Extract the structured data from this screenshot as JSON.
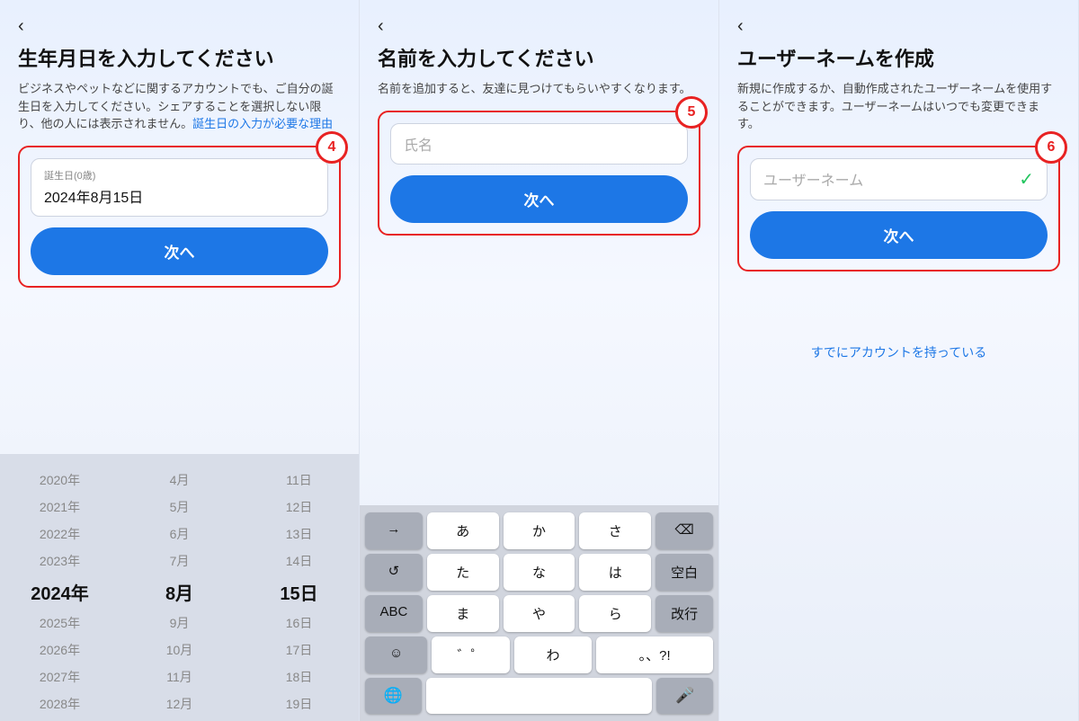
{
  "screen1": {
    "back": "‹",
    "title": "生年月日を入力してください",
    "desc": "ビジネスやペットなどに関するアカウントでも、ご自分の誕生日を入力してください。シェアすることを選択しない限り、他の人には表示されません。",
    "desc_link": "誕生日の入力が必要な理由",
    "input_label": "誕生日(0歳)",
    "input_value": "2024年8月15日",
    "next_btn": "次へ",
    "step": "4",
    "date_picker": {
      "years": [
        "2020年",
        "2021年",
        "2022年",
        "2023年",
        "2024年",
        "2025年",
        "2026年",
        "2027年",
        "2028年"
      ],
      "months": [
        "4月",
        "5月",
        "6月",
        "7月",
        "8月",
        "9月",
        "10月",
        "11月",
        "12月"
      ],
      "days": [
        "11日",
        "12日",
        "13日",
        "14日",
        "15日",
        "16日",
        "17日",
        "18日",
        "19日"
      ],
      "active_year": "2024年",
      "active_month": "8月",
      "active_day": "15日"
    }
  },
  "screen2": {
    "back": "‹",
    "title": "名前を入力してください",
    "desc": "名前を追加すると、友達に見つけてもらいやすくなります。",
    "input_placeholder": "氏名",
    "next_btn": "次へ",
    "step": "5",
    "keyboard": {
      "rows": [
        [
          "→",
          "あ",
          "か",
          "さ",
          "⌫"
        ],
        [
          "↺",
          "た",
          "な",
          "は",
          "空白"
        ],
        [
          "ABC",
          "ま",
          "や",
          "ら",
          "改行"
        ],
        [
          "☺",
          "^^",
          "わ",
          "。、?!",
          ""
        ]
      ]
    }
  },
  "screen3": {
    "back": "‹",
    "title": "ユーザーネームを作成",
    "desc": "新規に作成するか、自動作成されたユーザーネームを使用することができます。ユーザーネームはいつでも変更できます。",
    "input_placeholder": "ユーザーネーム",
    "next_btn": "次へ",
    "step": "6",
    "already_have": "すでにアカウントを持っている"
  }
}
